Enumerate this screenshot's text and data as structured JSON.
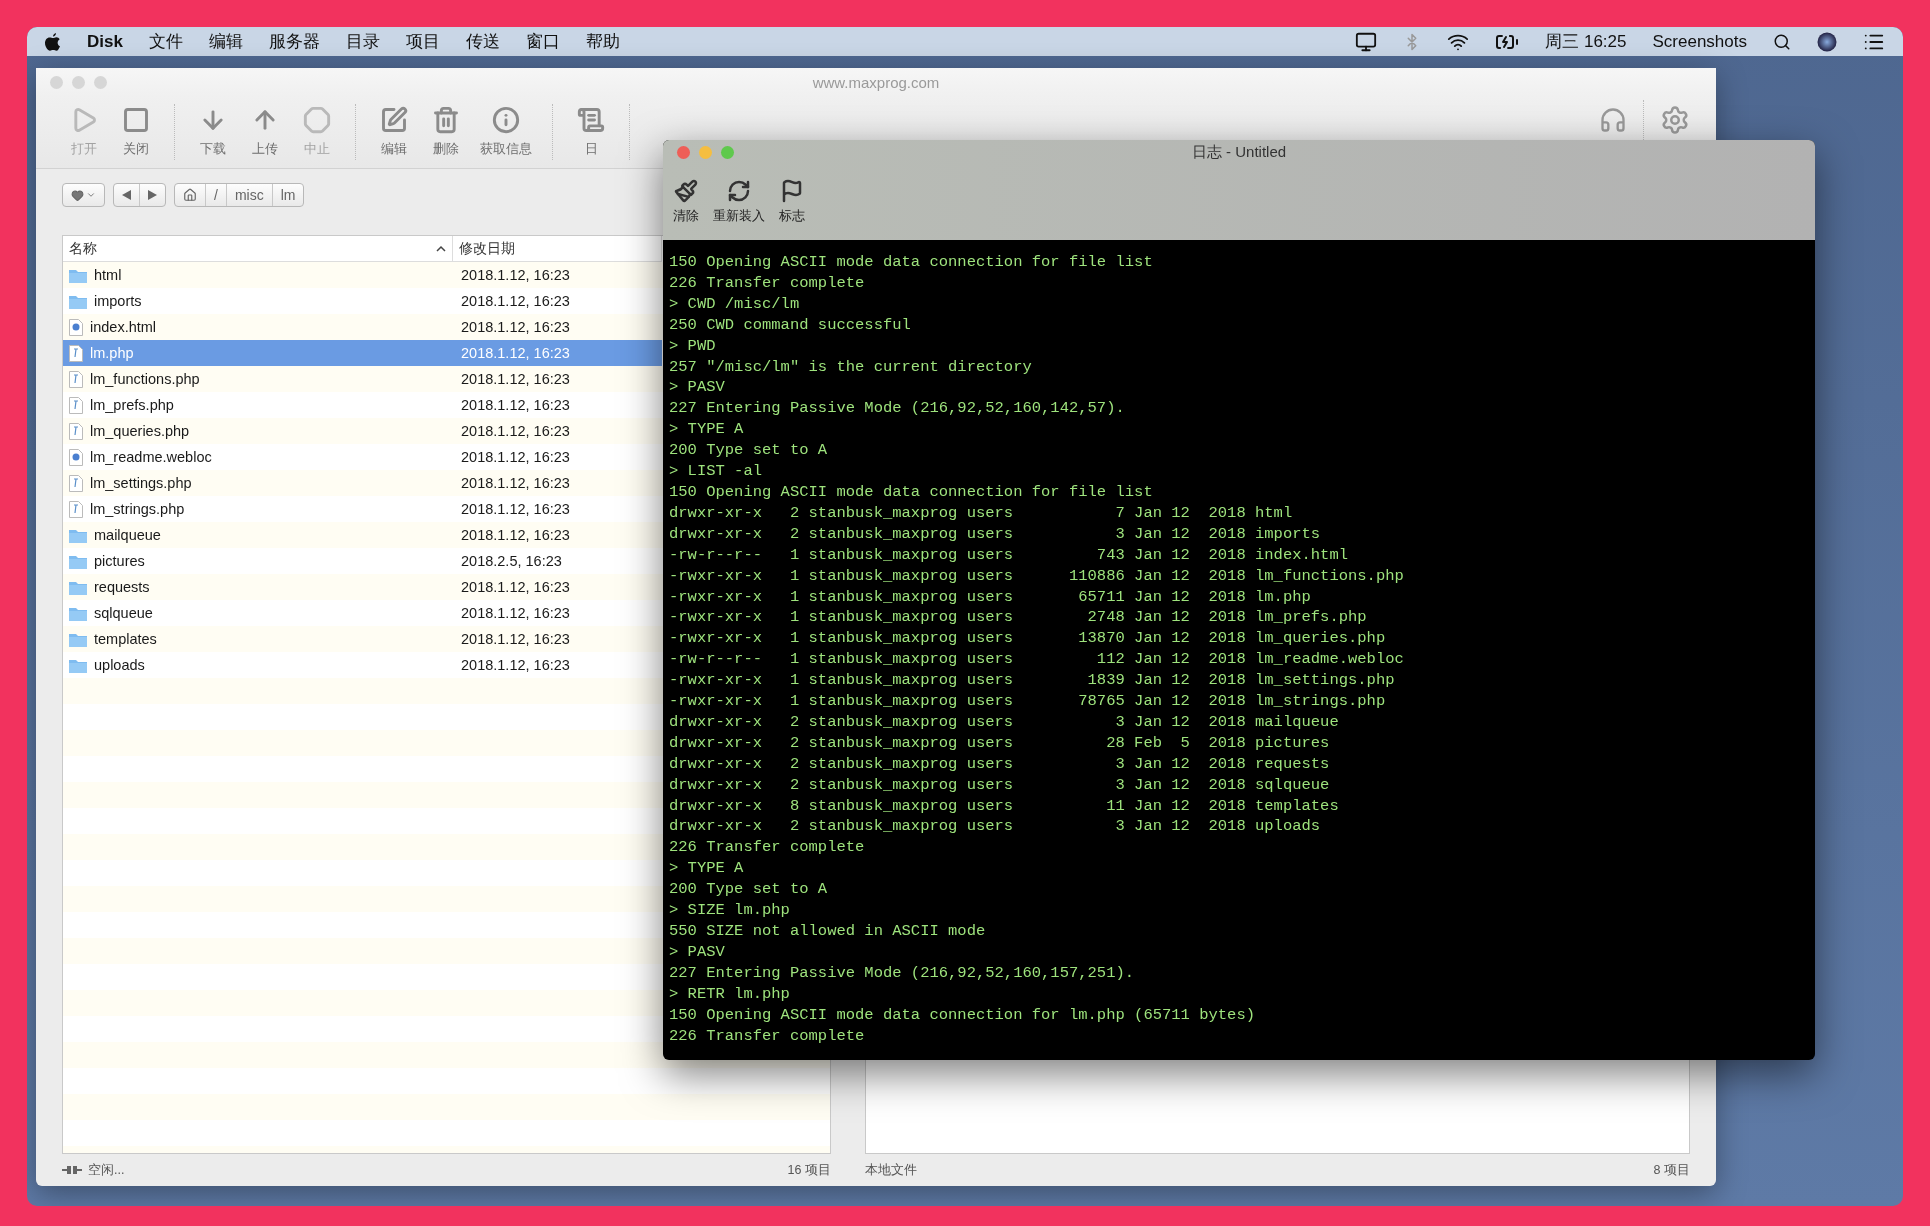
{
  "menu_bar": {
    "app_name": "Disk",
    "menus": [
      "文件",
      "编辑",
      "服务器",
      "目录",
      "项目",
      "传送",
      "窗口",
      "帮助"
    ],
    "clock": "周三 16:25",
    "user": "Screenshots"
  },
  "main_window": {
    "title": "www.maxprog.com",
    "toolbar_groups": [
      [
        {
          "kind": "play",
          "label": "打开",
          "disabled": true
        },
        {
          "kind": "stop",
          "label": "关闭",
          "disabled": false
        }
      ],
      [
        {
          "kind": "download",
          "label": "下载",
          "disabled": false
        },
        {
          "kind": "upload",
          "label": "上传",
          "disabled": false
        },
        {
          "kind": "abort",
          "label": "中止",
          "disabled": true
        }
      ],
      [
        {
          "kind": "edit",
          "label": "编辑",
          "disabled": false
        },
        {
          "kind": "delete",
          "label": "删除",
          "disabled": false
        },
        {
          "kind": "info",
          "label": "获取信息",
          "disabled": false
        }
      ],
      [
        {
          "kind": "log",
          "label": "日",
          "disabled": false
        }
      ]
    ],
    "path": [
      "/",
      "misc",
      "lm"
    ],
    "file_list": {
      "columns": [
        "名称",
        "修改日期"
      ],
      "rows": [
        {
          "name": "html",
          "date": "2018.1.12, 16:23",
          "kind": "folder",
          "selected": false
        },
        {
          "name": "imports",
          "date": "2018.1.12, 16:23",
          "kind": "folder",
          "selected": false
        },
        {
          "name": "index.html",
          "date": "2018.1.12, 16:23",
          "kind": "web",
          "selected": false
        },
        {
          "name": "lm.php",
          "date": "2018.1.12, 16:23",
          "kind": "php",
          "selected": true
        },
        {
          "name": "lm_functions.php",
          "date": "2018.1.12, 16:23",
          "kind": "php",
          "selected": false
        },
        {
          "name": "lm_prefs.php",
          "date": "2018.1.12, 16:23",
          "kind": "php",
          "selected": false
        },
        {
          "name": "lm_queries.php",
          "date": "2018.1.12, 16:23",
          "kind": "php",
          "selected": false
        },
        {
          "name": "lm_readme.webloc",
          "date": "2018.1.12, 16:23",
          "kind": "web",
          "selected": false
        },
        {
          "name": "lm_settings.php",
          "date": "2018.1.12, 16:23",
          "kind": "php",
          "selected": false
        },
        {
          "name": "lm_strings.php",
          "date": "2018.1.12, 16:23",
          "kind": "php",
          "selected": false
        },
        {
          "name": "mailqueue",
          "date": "2018.1.12, 16:23",
          "kind": "folder",
          "selected": false
        },
        {
          "name": "pictures",
          "date": "2018.2.5, 16:23",
          "kind": "folder",
          "selected": false
        },
        {
          "name": "requests",
          "date": "2018.1.12, 16:23",
          "kind": "folder",
          "selected": false
        },
        {
          "name": "sqlqueue",
          "date": "2018.1.12, 16:23",
          "kind": "folder",
          "selected": false
        },
        {
          "name": "templates",
          "date": "2018.1.12, 16:23",
          "kind": "folder",
          "selected": false
        },
        {
          "name": "uploads",
          "date": "2018.1.12, 16:23",
          "kind": "folder",
          "selected": false
        }
      ]
    },
    "status_left": "空闲...",
    "count_left": "16 项目",
    "status_right": "本地文件",
    "count_right": "8 项目"
  },
  "log_window": {
    "title": "日志 - Untitled",
    "toolbar": [
      {
        "kind": "clear",
        "label": "清除"
      },
      {
        "kind": "reload",
        "label": "重新装入"
      },
      {
        "kind": "mark",
        "label": "标志"
      }
    ],
    "lines": [
      "150 Opening ASCII mode data connection for file list",
      "226 Transfer complete",
      "> CWD /misc/lm",
      "250 CWD command successful",
      "> PWD",
      "257 \"/misc/lm\" is the current directory",
      "> PASV",
      "227 Entering Passive Mode (216,92,52,160,142,57).",
      "> TYPE A",
      "200 Type set to A",
      "> LIST -al",
      "150 Opening ASCII mode data connection for file list",
      "drwxr-xr-x   2 stanbusk_maxprog users           7 Jan 12  2018 html",
      "drwxr-xr-x   2 stanbusk_maxprog users           3 Jan 12  2018 imports",
      "-rw-r--r--   1 stanbusk_maxprog users         743 Jan 12  2018 index.html",
      "-rwxr-xr-x   1 stanbusk_maxprog users      110886 Jan 12  2018 lm_functions.php",
      "-rwxr-xr-x   1 stanbusk_maxprog users       65711 Jan 12  2018 lm.php",
      "-rwxr-xr-x   1 stanbusk_maxprog users        2748 Jan 12  2018 lm_prefs.php",
      "-rwxr-xr-x   1 stanbusk_maxprog users       13870 Jan 12  2018 lm_queries.php",
      "-rw-r--r--   1 stanbusk_maxprog users         112 Jan 12  2018 lm_readme.webloc",
      "-rwxr-xr-x   1 stanbusk_maxprog users        1839 Jan 12  2018 lm_settings.php",
      "-rwxr-xr-x   1 stanbusk_maxprog users       78765 Jan 12  2018 lm_strings.php",
      "drwxr-xr-x   2 stanbusk_maxprog users           3 Jan 12  2018 mailqueue",
      "drwxr-xr-x   2 stanbusk_maxprog users          28 Feb  5  2018 pictures",
      "drwxr-xr-x   2 stanbusk_maxprog users           3 Jan 12  2018 requests",
      "drwxr-xr-x   2 stanbusk_maxprog users           3 Jan 12  2018 sqlqueue",
      "drwxr-xr-x   8 stanbusk_maxprog users          11 Jan 12  2018 templates",
      "drwxr-xr-x   2 stanbusk_maxprog users           3 Jan 12  2018 uploads",
      "226 Transfer complete",
      "> TYPE A",
      "200 Type set to A",
      "> SIZE lm.php",
      "550 SIZE not allowed in ASCII mode",
      "> PASV",
      "227 Entering Passive Mode (216,92,52,160,157,251).",
      "> RETR lm.php",
      "150 Opening ASCII mode data connection for lm.php (65711 bytes)",
      "226 Transfer complete"
    ]
  }
}
